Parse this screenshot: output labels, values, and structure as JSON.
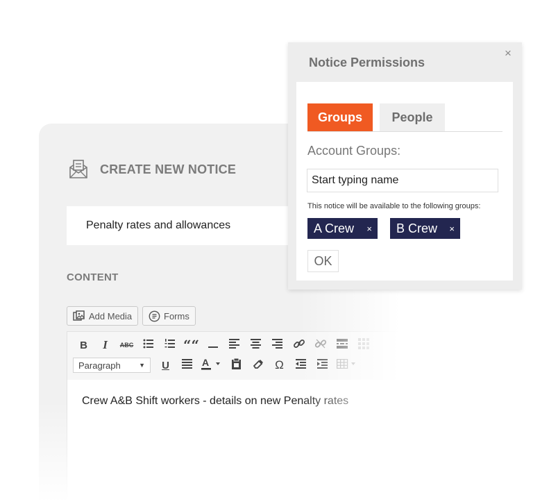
{
  "notice": {
    "title": "CREATE NEW NOTICE",
    "title_value": "Penalty rates and allowances",
    "content_label": "CONTENT",
    "add_media_label": "Add Media",
    "forms_label": "Forms",
    "format_select": "Paragraph",
    "toolbar": {
      "bold": "B",
      "italic": "I",
      "strike": "ABC",
      "blockquote": "““",
      "underline": "U",
      "omega": "Ω"
    },
    "editor_text": "Crew A&B Shift workers - details on new Penalty rates"
  },
  "permissions": {
    "title": "Notice Permissions",
    "close_glyph": "×",
    "tabs": [
      {
        "label": "Groups",
        "active": true
      },
      {
        "label": "People",
        "active": false
      }
    ],
    "account_groups_label": "Account Groups:",
    "search_value": "Start typing name",
    "availability_text": "This notice will be available to the following groups:",
    "groups": [
      {
        "label": "A Crew",
        "remove": "×"
      },
      {
        "label": "B Crew",
        "remove": "×"
      }
    ],
    "ok_label": "OK"
  },
  "colors": {
    "accent_orange": "#f05a22",
    "chip_navy": "#232650",
    "card_gray": "#f1f1f1"
  }
}
